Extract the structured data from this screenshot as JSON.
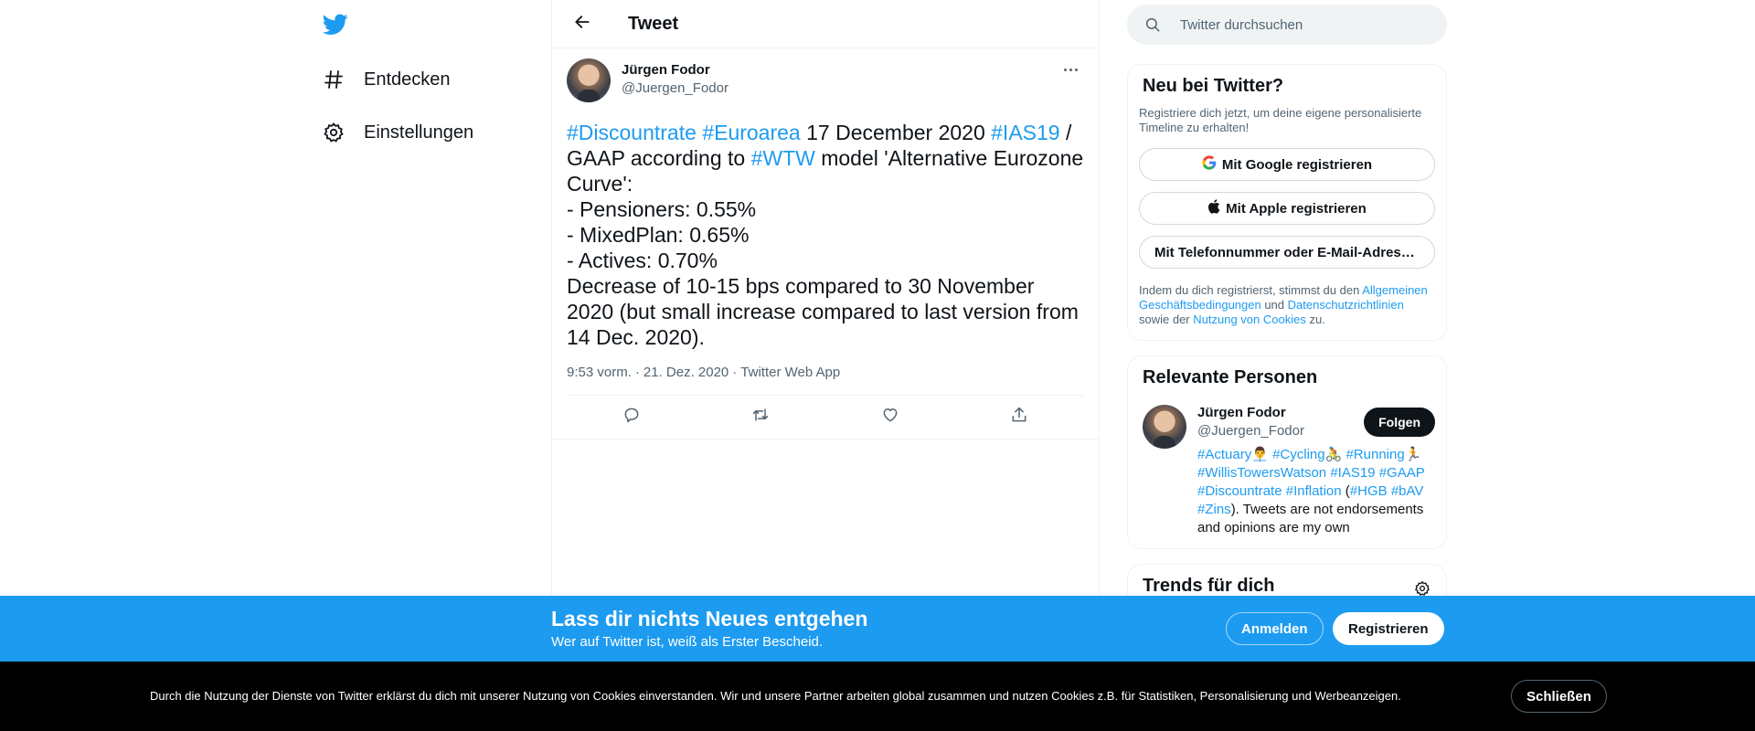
{
  "colors": {
    "accent": "#1d9bf0",
    "text": "#0f1419",
    "muted": "#536471",
    "border": "#eff3f4"
  },
  "nav": {
    "logo_icon": "twitter-bird-icon",
    "items": [
      {
        "label": "Entdecken",
        "icon": "hashtag-icon"
      },
      {
        "label": "Einstellungen",
        "icon": "gear-icon"
      }
    ]
  },
  "header": {
    "title": "Tweet",
    "back_icon": "arrow-left-icon"
  },
  "tweet": {
    "author_name": "Jürgen Fodor",
    "author_handle": "@Juergen_Fodor",
    "text_parts": {
      "tag1": "#Discountrate",
      "tag2": "#Euroarea",
      "t1": " 17 December 2020 ",
      "tag3": "#IAS19",
      "t2": " / GAAP according to ",
      "tag4": "#WTW",
      "t3": " model 'Alternative Eurozone Curve':\n- Pensioners: 0.55%\n- MixedPlan: 0.65%\n- Actives: 0.70%\nDecrease of 10-15 bps compared to 30 November 2020 (but small increase compared to last version from 14 Dec. 2020)."
    },
    "time": "9:53 vorm.",
    "date": "21. Dez. 2020",
    "source": "Twitter Web App",
    "separator": "·"
  },
  "search": {
    "placeholder": "Twitter durchsuchen"
  },
  "signup": {
    "title": "Neu bei Twitter?",
    "description": "Registriere dich jetzt, um deine eigene personalisierte Timeline zu erhalten!",
    "google": "Mit Google registrieren",
    "apple": "Mit Apple registrieren",
    "phone": "Mit Telefonnummer oder E-Mail-Adresse registrieren",
    "legal_1": "Indem du dich registrierst, stimmst du den ",
    "legal_link_1": "Allgemeinen Geschäftsbedingungen",
    "legal_2": " und ",
    "legal_link_2": "Datenschutzrichtlinien",
    "legal_3": " sowie der ",
    "legal_link_3": "Nutzung von Cookies",
    "legal_4": " zu."
  },
  "people": {
    "title": "Relevante Personen",
    "name": "Jürgen Fodor",
    "handle": "@Juergen_Fodor",
    "follow": "Folgen",
    "bio": {
      "b1": "#Actuary",
      "e1": "👨‍💼",
      "b2": "#Cycling",
      "e2": "🚴",
      "b3": "#Running",
      "e3": "🏃",
      "b4": "#WillisTowersWatson",
      "b5": "#IAS19",
      "b6": "#GAAP",
      "b7": "#Discountrate",
      "b8": "#Inflation",
      "p1": " (",
      "b9": "#HGB",
      "b10": "#bAV",
      "b11": "#Zins",
      "tail": "). Tweets are not endorsements and opinions are my own"
    }
  },
  "trends": {
    "title": "Trends für dich"
  },
  "promo": {
    "title": "Lass dir nichts Neues entgehen",
    "subtitle": "Wer auf Twitter ist, weiß als Erster Bescheid.",
    "login": "Anmelden",
    "register": "Registrieren"
  },
  "cookie": {
    "text": "Durch die Nutzung der Dienste von Twitter erklärst du dich mit unserer Nutzung von Cookies einverstanden. Wir und unsere Partner arbeiten global zusammen und nutzen Cookies z.B. für Statistiken, Personalisierung und Werbeanzeigen.",
    "close": "Schließen"
  }
}
